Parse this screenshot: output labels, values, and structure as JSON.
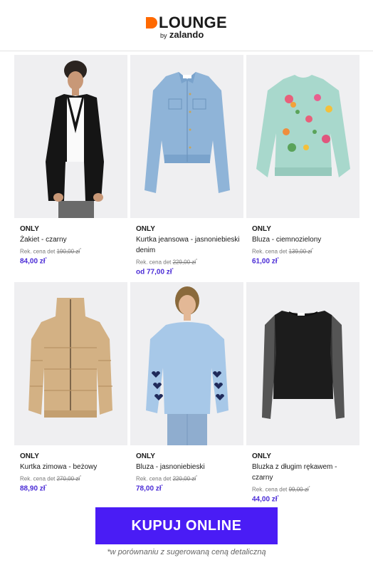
{
  "header": {
    "logo_word": "LOUNGE",
    "logo_by": "by",
    "logo_brand": "zalando",
    "accent_color": "#ff6900"
  },
  "products": [
    {
      "brand": "ONLY",
      "name": "Żakiet - czarny",
      "rek_label": "Rek. cena det",
      "rek_price": "190,00 zł",
      "price": "84,00 zł",
      "icon": "black-blazer-model"
    },
    {
      "brand": "ONLY",
      "name": "Kurtka jeansowa - jasnoniebieski denim",
      "rek_label": "Rek. cena det",
      "rek_price": "229,00 zł",
      "price": "od 77,00 zł",
      "icon": "denim-jacket"
    },
    {
      "brand": "ONLY",
      "name": "Bluza - ciemnozielony",
      "rek_label": "Rek. cena det",
      "rek_price": "139,00 zł",
      "price": "61,00 zł",
      "icon": "floral-sweatshirt"
    },
    {
      "brand": "ONLY",
      "name": "Kurtka zimowa - beżowy",
      "rek_label": "Rek. cena det",
      "rek_price": "270,00 zł",
      "price": "88,90 zł",
      "icon": "puffer-jacket"
    },
    {
      "brand": "ONLY",
      "name": "Bluza - jasnoniebieski",
      "rek_label": "Rek. cena det",
      "rek_price": "220,00 zł",
      "price": "78,00 zł",
      "icon": "heart-sweatshirt-model"
    },
    {
      "brand": "ONLY",
      "name": "Bluzka z długim rękawem - czarny",
      "rek_label": "Rek. cena det",
      "rek_price": "99,00 zł",
      "price": "44,00 zł",
      "icon": "sheer-sleeve-top"
    }
  ],
  "cta": {
    "label": "KUPUJ ONLINE",
    "color": "#4a1cf5"
  },
  "footnote": "*w porównaniu z sugerowaną ceną detaliczną",
  "price_color": "#4a2bd6"
}
